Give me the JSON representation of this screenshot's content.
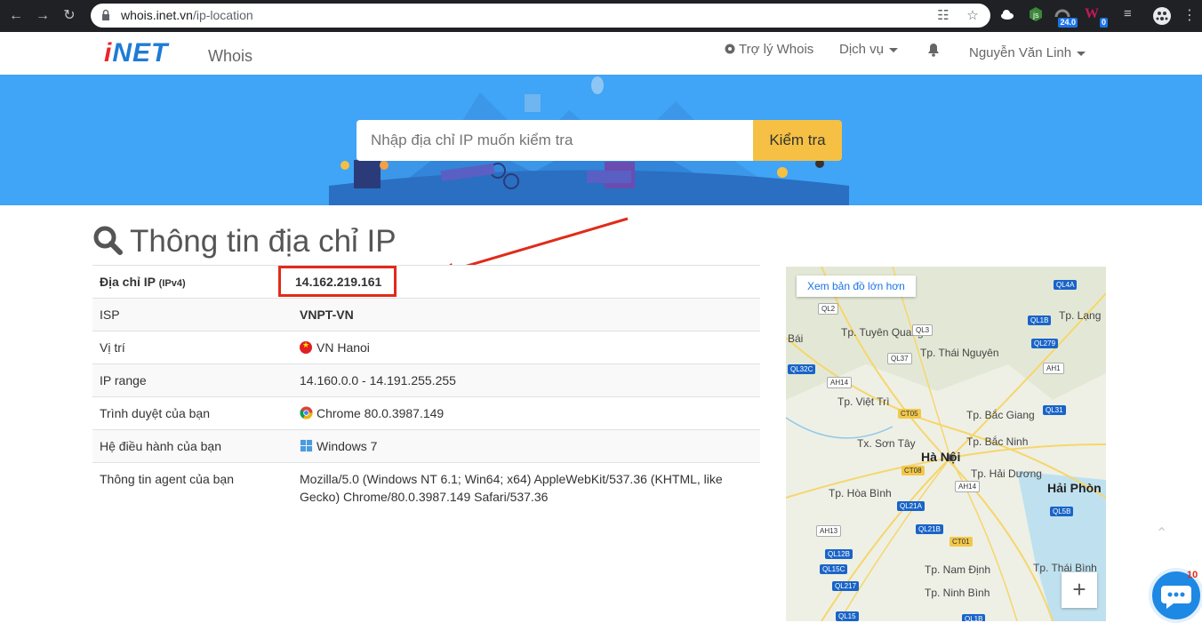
{
  "browser": {
    "url_host": "whois.inet.vn",
    "url_path": "/ip-location",
    "extensions": [
      {
        "name": "cloud-extension-icon",
        "badge": ""
      },
      {
        "name": "nodejs-extension-icon",
        "badge": ""
      },
      {
        "name": "speed-extension-icon",
        "badge": "24.0"
      },
      {
        "name": "w-extension-icon",
        "badge": "0"
      },
      {
        "name": "playlist-extension-icon",
        "badge": ""
      }
    ]
  },
  "header": {
    "logo_i": "i",
    "logo_rest": "NET",
    "logo_sub": "Whois",
    "nav": {
      "assistant": "Trợ lý Whois",
      "services": "Dịch vụ",
      "user": "Nguyễn Văn Linh"
    }
  },
  "hero": {
    "search_placeholder": "Nhập địa chỉ IP muốn kiểm tra",
    "search_button": "Kiểm tra"
  },
  "main": {
    "title": "Thông tin địa chỉ IP",
    "rows": [
      {
        "label": "Địa chỉ IP",
        "label_suffix": "(IPv4)",
        "value": "14.162.219.161"
      },
      {
        "label": "ISP",
        "value": "VNPT-VN"
      },
      {
        "label": "Vị trí",
        "value": "VN Hanoi"
      },
      {
        "label": "IP range",
        "value": "14.160.0.0 - 14.191.255.255"
      },
      {
        "label": "Trình duyệt của bạn",
        "value": "Chrome 80.0.3987.149"
      },
      {
        "label": "Hệ điều hành của bạn",
        "value": "Windows 7"
      },
      {
        "label": "Thông tin agent của bạn",
        "value": "Mozilla/5.0 (Windows NT 6.1; Win64; x64) AppleWebKit/537.36 (KHTML, like Gecko) Chrome/80.0.3987.149 Safari/537.36"
      }
    ]
  },
  "map": {
    "link": "Xem bản đồ lớn hơn",
    "zoom_in": "+",
    "cities": [
      {
        "name": "Tp. Tuyên Quang"
      },
      {
        "name": "Tp. Thái Nguyên"
      },
      {
        "name": "Tp. Lạng"
      },
      {
        "name": "Bái"
      },
      {
        "name": "Tp. Việt Trì"
      },
      {
        "name": "Tp. Bắc Giang"
      },
      {
        "name": "Tx. Sơn Tây"
      },
      {
        "name": "Tp. Bắc Ninh"
      },
      {
        "name": "Hà Nội"
      },
      {
        "name": "Tp. Hải Dương"
      },
      {
        "name": "Hải Phòn"
      },
      {
        "name": "Tp. Hòa Bình"
      },
      {
        "name": "Tp. Nam Định"
      },
      {
        "name": "Tp. Thái Bình"
      },
      {
        "name": "Tp. Ninh Bình"
      }
    ],
    "roads": [
      "QL2",
      "QL3",
      "QL37",
      "QL4A",
      "QL1B",
      "QL279",
      "AH1",
      "QL32C",
      "AH14",
      "CT05",
      "QL31",
      "CT08",
      "AH14",
      "QL21A",
      "QL5B",
      "AH13",
      "QL21B",
      "CT01",
      "QL12B",
      "QL15C",
      "QL217",
      "QL15",
      "QL1B"
    ]
  },
  "chat": {
    "badge": "10"
  }
}
